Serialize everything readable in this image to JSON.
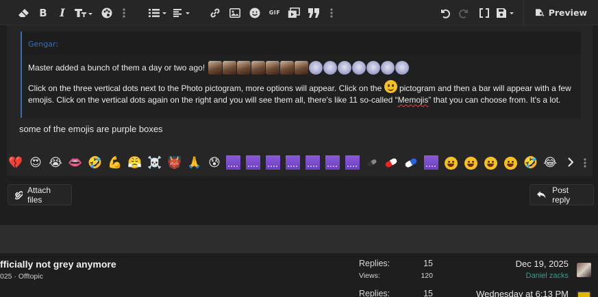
{
  "toolbar": {
    "left_icons": [
      "eraser-icon",
      "bold-icon",
      "italic-icon",
      "text-size-icon",
      "palette-icon",
      "more-vertical-icon",
      "list-icon",
      "align-icon",
      "link-icon",
      "image-icon",
      "smiley-icon",
      "gif-icon",
      "media-icon",
      "quote-icon",
      "more-vertical-icon"
    ],
    "gif_label": "GIF",
    "right_icons": [
      "undo-icon",
      "redo-icon",
      "fullscreen-icon",
      "save-draft-icon"
    ],
    "preview_label": "Preview"
  },
  "quote": {
    "author": "Gengar:",
    "line1": "Master added a bunch of them a day or two ago!",
    "para_before_icon": "Click on the three vertical dots next to the Photo pictogram, more options will appear. Click on the",
    "para_after_icon": "pictogram and then a bar will appear with a few emojis. Click on the vertical dots again on the right and you will see them all, there's like 11 so-called “",
    "para_misspelled": "Memojis",
    "para_end": "” that you can choose from. It's a lot."
  },
  "reply_text": "some of the emojis are purple boxes",
  "emoji_bar": {
    "chars": [
      "💔",
      "😍",
      "😭",
      "👄",
      "🤣",
      "💪",
      "😤",
      "☠️",
      "👹",
      "🙏",
      "😰"
    ],
    "trailing_chars": [
      "🤣",
      "😂"
    ],
    "purple_box_count": 8
  },
  "actions": {
    "attach_label": "Attach files",
    "post_label": "Post reply"
  },
  "threads": [
    {
      "title": "fficially not grey anymore",
      "meta": "025 · Offtopic",
      "replies_label": "Replies:",
      "replies": "15",
      "views_label": "Views:",
      "views": "120",
      "date": "Dec 19, 2025",
      "user": "Daniel zacks"
    },
    {
      "replies_label": "Replies:",
      "replies": "15",
      "date": "Wednesday at 6:13 PM"
    }
  ],
  "colors": {
    "accent_blue": "#3f6db3",
    "user_teal": "#3d9a8c",
    "purple_box": "#7a4cd0"
  }
}
